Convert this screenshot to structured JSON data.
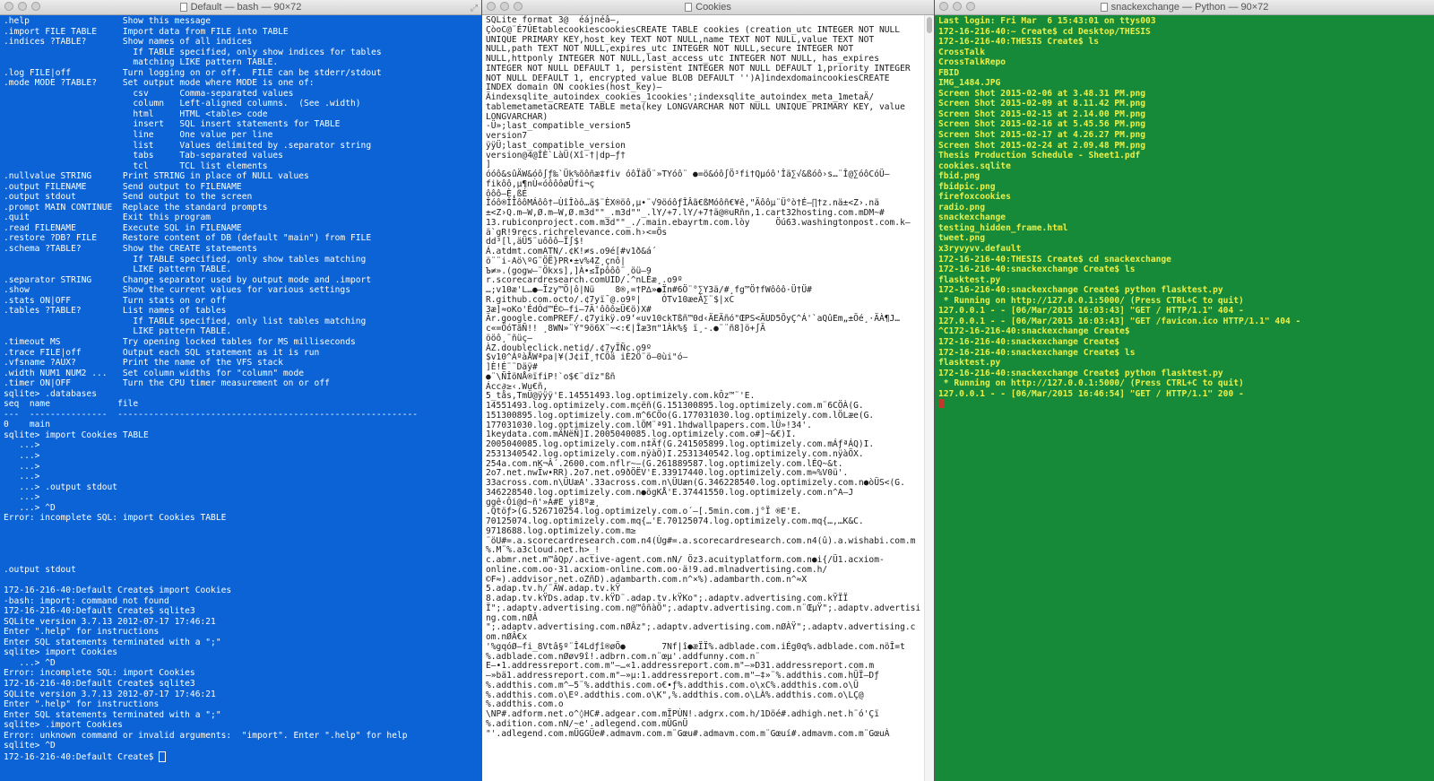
{
  "windows": {
    "bash": {
      "title": "Default — bash — 90×72",
      "resize_glyph": "⤢",
      "lines": [
        ".help                  Show this message",
        ".import FILE TABLE     Import data from FILE into TABLE",
        ".indices ?TABLE?       Show names of all indices",
        "                         If TABLE specified, only show indices for tables",
        "                         matching LIKE pattern TABLE.",
        ".log FILE|off          Turn logging on or off.  FILE can be stderr/stdout",
        ".mode MODE ?TABLE?     Set output mode where MODE is one of:",
        "                         csv      Comma-separated values",
        "                         column   Left-aligned columns.  (See .width)",
        "                         html     HTML <table> code",
        "                         insert   SQL insert statements for TABLE",
        "                         line     One value per line",
        "                         list     Values delimited by .separator string",
        "                         tabs     Tab-separated values",
        "                         tcl      TCL list elements",
        ".nullvalue STRING      Print STRING in place of NULL values",
        ".output FILENAME       Send output to FILENAME",
        ".output stdout         Send output to the screen",
        ".prompt MAIN CONTINUE  Replace the standard prompts",
        ".quit                  Exit this program",
        ".read FILENAME         Execute SQL in FILENAME",
        ".restore ?DB? FILE     Restore content of DB (default \"main\") from FILE",
        ".schema ?TABLE?        Show the CREATE statements",
        "                         If TABLE specified, only show tables matching",
        "                         LIKE pattern TABLE.",
        ".separator STRING      Change separator used by output mode and .import",
        ".show                  Show the current values for various settings",
        ".stats ON|OFF          Turn stats on or off",
        ".tables ?TABLE?        List names of tables",
        "                         If TABLE specified, only list tables matching",
        "                         LIKE pattern TABLE.",
        ".timeout MS            Try opening locked tables for MS milliseconds",
        ".trace FILE|off        Output each SQL statement as it is run",
        ".vfsname ?AUX?         Print the name of the VFS stack",
        ".width NUM1 NUM2 ...   Set column widths for \"column\" mode",
        ".timer ON|OFF          Turn the CPU timer measurement on or off",
        "sqlite> .databases",
        "seq  name             file",
        "---  ---------------  ----------------------------------------------------------",
        "0    main",
        "sqlite> import Cookies TABLE",
        "   ...>",
        "   ...>",
        "   ...>",
        "   ...>",
        "   ...> .output stdout",
        "   ...>",
        "   ...> ^D",
        "Error: incomplete SQL: import Cookies TABLE",
        "",
        "",
        "",
        "",
        ".output stdout",
        "",
        "172-16-216-40:Default Create$ import Cookies",
        "-bash: import: command not found",
        "172-16-216-40:Default Create$ sqlite3",
        "SQLite version 3.7.13 2012-07-17 17:46:21",
        "Enter \".help\" for instructions",
        "Enter SQL statements terminated with a \";\"",
        "sqlite> import Cookies",
        "   ...> ^D",
        "Error: incomplete SQL: import Cookies",
        "172-16-216-40:Default Create$ sqlite3",
        "SQLite version 3.7.13 2012-07-17 17:46:21",
        "Enter \".help\" for instructions",
        "Enter SQL statements terminated with a \";\"",
        "sqlite> .import Cookies",
        "Error: unknown command or invalid arguments:  \"import\". Enter \".help\" for help",
        "sqlite> ^D",
        "172-16-216-40:Default Create$ "
      ]
    },
    "cookies": {
      "title": "Cookies",
      "lines": [
        "SQLite format 3@  éájnéâ–,",
        "ÇòoC@¨É7ÛEtablecookiescookiesCREATE TABLE cookies (creation_utc INTEGER NOT NULL",
        "UNIQUE PRIMARY KEY,host_key TEXT NOT NULL,name TEXT NOT NULL,value TEXT NOT",
        "NULL,path TEXT NOT NULL,expires_utc INTEGER NOT NULL,secure INTEGER NOT",
        "NULL,httponly INTEGER NOT NULL,last_access_utc INTEGER NOT NULL, has_expires",
        "INTEGER NOT NULL DEFAULT 1, persistent INTEGER NOT NULL DEFAULT 1,priority INTEGER",
        "NOT NULL DEFAULT 1, encrypted_value BLOB DEFAULT '')A]indexdomaincookiesCREATE",
        "INDEX domain ON cookies(host_key)–",
        "Äindexsqlite_autoindex_cookies_1cookies';indexsqlite_autoindex_meta_1meta\fÄ/",
        "tablemetametaCREATE TABLE meta(key LONGVARCHAR NOT NULL UNIQUE PRIMARY KEY, value",
        "LONGVARCHAR)",
        "-Ü»;last_compatible_version5",
        "version7",
        "ÿÿÜ;last_compatible_version",
        "version@4@ÎÈ`LàÜ(Xî-†|dp–ƒ†",
        "]",
        "óóô&sûÄW&óô∫ƒ‰`Ük%õôñæ‡fiv óôÏäÕ¨»TYóô¨ ●=ö&óô∫Ö³fi†Qµóô'Îä∑√&ßóô›s…¨Î@∑óôCóÜ–",
        "fikôô,µ¶nÙ«óôôôøÜfi¬ç",
        "ôôô–È,ßÉ",
        "Îóô®ÎÎôôMÁôô†–ÙîÎòô…ä$¨ÈX®öô,µ•¨√9öóôƒÎÂã€ßMóôñ€¥ê,\"Äôôµ¨Ü°ò†É–∏†z.nä±<Z›.nä",
        "±<Z›Q.m–W,Ø.m–W,Ø.m3d\"\"_.m3d\"\"_.lY/+7.lY/+7†ä@®uRñn,1.cart32hosting.com.mDM~#",
        "13.rubiconproject.com.m3d\"\"_./.main.ebayrtm.com.lòy     Öú63.washingtonpost.com.k–",
        "ä`gR!9recs.richrelevance.com.h›<=Ös",
        "dd³[l,äÜ5¨uôôô–Ï∫$!",
        "Á.atdmt.comATN/.¢K!≠s.o9é[#v1ð&á´",
        "ö¨¨i-Aö\\ºG¨ÖË}PR•±v%4Z¸çnô|",
        "Ъ≠».(gogw–¨Ökxs],]À•≤Ïpôôô¨¸öü–9",
        "r.scorecardresearch.comUID/.^nLÈæ¸.o9º",
        "…;v10æ'L…●–Ïzy™Ö|ô|Nü    8®,=†P∆»●Ïn#6Ö¨°∑Y3ä/#¸fg™Ö†fWôôô·Ü†Ü#",
        "R.github.com.octo/.¢7yï¯@.o9º|    ÓTv10æeÀ∑¨$|xC",
        "3æ]≈oKo'ÉdÓd™É©–fi–7Ä'ôôô≥Ü€ö)X#",
        "Är.google.comPREF/.¢7yikÿ.o9‘«uv10ckTßñ™0d‹ÄEÄñó\"ŒPS<ÄUD5ÕyÇ^Á'`aQûEm„±Öé¸·ÄÀ¶J…",
        "c«=ÖóTãÑ!! ¸8WN»¨Ý\"9ö6X¨~<:€|Îæ3π\"1Àk%§ ï¸-.●¨¨ñ8]ö+∫Ä",
        "ööô¸¨ñüç–",
        "ÀZ.doubleclick.netid/.¢7yÏÑc.o9º",
        "$v10^ÁºàÅWªpa|¥(J¢iÎ¸†CÖä iÈ2Ö¨ö–0ùi\"ó–",
        "]È!É¨¨Däÿ#",
        "●¨\\ÑÎöNÅ®ïfiP!`o$€¨dïz\"ßñ",
        "Ácc∂≥‹.Wu€ñ,",
        "5_tås,TmÜ@ÿÿÿ'E.14551493.log.optimizely.com.kÔz™¨'E.",
        "14551493.log.optimizely.com.mçëñ(G.151300895.log.optimizely.com.m¨6CÖÀ(G.",
        "151300895.log.optimizely.com.m^6CÖo(G.177031030.log.optimizely.com.lÖLæe(G.",
        "177031030.log.optimizely.com.lÖM¨ª91.1hdwallpapers.com.lÜ»!34'.",
        "1keydata.com.mÄNëÑ]I.2005040085.log.optimizely.com.o#]~&€)I.",
        "2005040085.log.optimizely.com.n‡Äf(G.241505899.log.optimizely.com.mÁƒªÁQ)I.",
        "2531340542.log.optimizely.com.nÿàÖ)I.2531340542.log.optimizely.com.nÿàÖX.",
        "254a.com.nK¬Â´.2600.com.nflr~–(G.261889587.log.optimizely.com.lÉQ~&t.",
        "2o7.net.nwÏw•RR).2o7.net.o9ðÖËV'E.33917440.log.optimizely.com.m≈%V0ü'.",
        "33across.com.n\\ÜUæA'.33across.com.n\\ÜUæn(G.346228540.log.optimizely.com.n●òÜS<(G.",
        "346228540.log.optimizely.com.n●ögKÅ'E.37441550.log.optimizely.com.n^A–J",
        "ggê‹Ôi@d~ñ'»Á#E_yi8ºæ¸",
        ".Qtöƒ>(G.526710254.log.optimizely.com.o´–[.5min.com.j°Ï ®E'E.",
        "70125074.log.optimizely.com.mq{…'E.70125074.log.optimizely.com.mq{…,…K&C.",
        "9718688.log.optimizely.com.m≥",
        "¨öU#=.a.scorecardresearch.com.n4(Ùg#=.a.scorecardresearch.com.n4(û).a.wishabi.com.m",
        "%.M¨%.a3cloud.net.h>_!",
        "c.abmr.net.m™âQp/.active-agent.com.nN/ Öz3.acuityplatform.com.n●i{/Ü1.acxiom-",
        "online.com.oo·31.acxiom-online.com.oo·ä!9.ad.mlnadvertising.com.h/",
        "©F≈).addvisor.net.oZñD).adambarth.com.n^×%).adambarth.com.n^≈X",
        "5.adap.tv.h/¨ÄW.adap.tv.kŸ",
        "8.adap.tv.kŸDs.adap.tv.kŸD¨.adap.tv.kŸKo\";.adaptv.advertising.com.kŸÏÏ",
        "Ï\";.adaptv.advertising.com.n@™ôñàÖ\";.adaptv.advertising.com.n¨ŒµŸ\";.adaptv.advertisi",
        "ng.com.nØÂ",
        "\";.adaptv.advertising.com.nØÂz\";.adaptv.advertising.com.nØÀŸ\";.adaptv.advertising.c",
        "om.nØÂ€x",
        "'%gqóØ–fi_8Vtâ§º¨Î4Ldƒî®øÖ●       7Nf|î●æÏÏ%.adblade.com.iÉg0q%.adblade.com.nöÎ=t",
        "%.adblade.com.nØøv9î!.adbrn.com.n¨œµ'.addfunny.com.n¨",
        "E–•1.addressreport.com.m\"–…«1.addressreport.com.m\"–»D31.addressreport.com.m",
        "–»bä1.addressreport.com.m\"–»µ:1.addressreport.com.m\"–‡»¨%.addthis.com.hÜÏ–Dƒ",
        "%.addthis.com.m^–5¨%.addthis.com.o€•ƒ%.addthis.com.o\\xC%.addthis.com.o\\Ü",
        "%.addthis.com.o\\Eº.addthis.com.o\\K\",%.addthis.com.o\\LÀ%.addthis.com.o\\LÇ@",
        "%.addthis.com.o",
        "\\NP#.adform.net.o^◊HC#.adgear.com.mÏPÙN!.adgrx.com.h/1Döé#.adhigh.net.h¨ó'Çï",
        "%.adition.com.nN/~e'.adlegend.com.mÜGnÜ",
        "\"'.adlegend.com.mÜGGÜe#.admavm.com.m¨Gœu#.admavm.com.m¨Gœuí#.admavm.com.m¨GœuÀ"
      ]
    },
    "python": {
      "title": "snackexchange — Python — 90×72",
      "lines": [
        "Last login: Fri Mar  6 15:43:01 on ttys003",
        "172-16-216-40:~ Create$ cd Desktop/THESIS",
        "172-16-216-40:THESIS Create$ ls",
        "CrossTalk",
        "CrossTalkRepo",
        "FBID",
        "IMG_1484.JPG",
        "Screen Shot 2015-02-06 at 3.48.31 PM.png",
        "Screen Shot 2015-02-09 at 8.11.42 PM.png",
        "Screen Shot 2015-02-15 at 2.14.00 PM.png",
        "Screen Shot 2015-02-16 at 5.45.56 PM.png",
        "Screen Shot 2015-02-17 at 4.26.27 PM.png",
        "Screen Shot 2015-02-24 at 2.09.48 PM.png",
        "Thesis Production Schedule - Sheet1.pdf",
        "cookies.sqlite",
        "fbid.png",
        "fbidpic.png",
        "firefoxcookies",
        "radio.png",
        "snackexchange",
        "testing_hidden_frame.html",
        "tweet.png",
        "x3ryvyvv.default",
        "172-16-216-40:THESIS Create$ cd snackexchange",
        "172-16-216-40:snackexchange Create$ ls",
        "flasktest.py",
        "172-16-216-40:snackexchange Create$ python flasktest.py",
        " * Running on http://127.0.0.1:5000/ (Press CTRL+C to quit)",
        "127.0.0.1 - - [06/Mar/2015 16:03:43] \"GET / HTTP/1.1\" 404 -",
        "127.0.0.1 - - [06/Mar/2015 16:03:43] \"GET /favicon.ico HTTP/1.1\" 404 -",
        "^C172-16-216-40:snackexchange Create$",
        "172-16-216-40:snackexchange Create$",
        "172-16-216-40:snackexchange Create$ ls",
        "flasktest.py",
        "172-16-216-40:snackexchange Create$ python flasktest.py",
        " * Running on http://127.0.0.1:5000/ (Press CTRL+C to quit)",
        "127.0.0.1 - - [06/Mar/2015 16:46:54] \"GET / HTTP/1.1\" 200 -"
      ]
    }
  },
  "colors": {
    "bash_bg": "#0b63d6",
    "bash_fg": "#ffffff",
    "python_bg": "#178a39",
    "python_fg": "#e8f04a",
    "editor_bg": "#ffffff"
  }
}
